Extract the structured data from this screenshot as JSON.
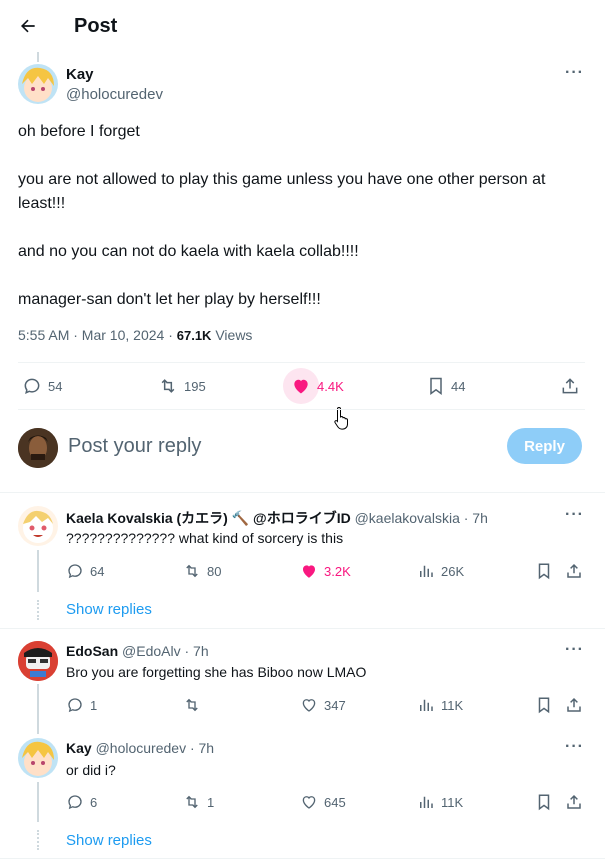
{
  "header": {
    "title": "Post"
  },
  "main_post": {
    "author_name": "Kay",
    "author_handle": "@holocuredev",
    "lines": [
      "oh before I forget",
      "you are not allowed to play this game unless you have one other person at least!!!",
      "and no you can not do kaela with kaela collab!!!!",
      "manager-san don't let her play by herself!!!"
    ],
    "timestamp": "5:55 AM · Mar 10, 2024 · ",
    "views_count": "67.1K",
    "views_label": " Views",
    "replies": "54",
    "reposts": "195",
    "likes": "4.4K",
    "bookmarks": "44"
  },
  "reply_box": {
    "placeholder": "Post your reply",
    "button": "Reply"
  },
  "replies": [
    {
      "name": "Kaela Kovalskia (カエラ) 🔨 @ホロライブID",
      "handle": "@kaelakovalskia · 7h",
      "text": "?????????????? what kind of sorcery is this",
      "replies": "64",
      "reposts": "80",
      "likes": "3.2K",
      "views": "26K",
      "show_replies": "Show replies"
    },
    {
      "name": "EdoSan",
      "handle": "@EdoAlv · 7h",
      "text": "Bro you are forgetting she has Biboo now LMAO",
      "replies": "1",
      "reposts": "",
      "likes": "347",
      "views": "11K"
    },
    {
      "name": "Kay",
      "handle": "@holocuredev · 7h",
      "text": "or did i?",
      "replies": "6",
      "reposts": "1",
      "likes": "645",
      "views": "11K",
      "show_replies": "Show replies"
    }
  ],
  "colors": {
    "accent": "#1d9bf0",
    "like": "#f91880",
    "muted": "#536471"
  }
}
